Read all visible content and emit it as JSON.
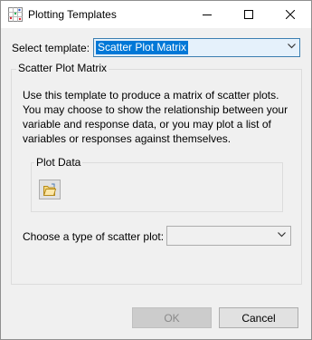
{
  "window": {
    "title": "Plotting Templates",
    "icon": "scatter-plot-icon"
  },
  "template_row": {
    "label": "Select template:",
    "selected": "Scatter Plot Matrix"
  },
  "group": {
    "legend": "Scatter Plot Matrix",
    "description_lines": [
      "Use this template to produce a matrix of scatter plots.",
      "You may choose to show the relationship between your",
      "variable and response data, or you may plot a list of",
      "variables or responses against themselves."
    ]
  },
  "plot_data": {
    "legend": "Plot Data",
    "button_icon": "open-folder-icon"
  },
  "scatter_type": {
    "label": "Choose a type of scatter plot:",
    "selected": ""
  },
  "buttons": {
    "ok": "OK",
    "cancel": "Cancel"
  },
  "colors": {
    "accent": "#0078d7",
    "dialog_bg": "#f0f0f0",
    "disabled_button": "#cccccc"
  }
}
